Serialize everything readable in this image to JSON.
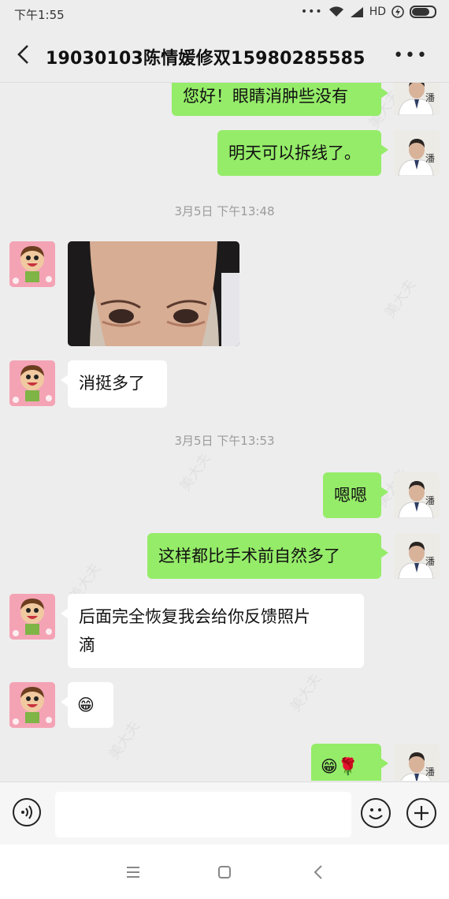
{
  "status_bar": {
    "time": "下午1:55",
    "network": "HD"
  },
  "header": {
    "title": "19030103陈情媛修双15980285585",
    "more": "•••"
  },
  "messages": [
    {
      "side": "right",
      "text": "您好！眼睛消肿些没有"
    },
    {
      "side": "right",
      "text": "明天可以拆线了。"
    },
    {
      "type": "timestamp",
      "text": "3月5日 下午13:48"
    },
    {
      "side": "left",
      "type": "image"
    },
    {
      "side": "left",
      "text": "消挺多了"
    },
    {
      "type": "timestamp",
      "text": "3月5日 下午13:53"
    },
    {
      "side": "right",
      "text": "嗯嗯"
    },
    {
      "side": "right",
      "text": "这样都比手术前自然多了"
    },
    {
      "side": "left",
      "line1": "后面完全恢复我会给你反馈照片",
      "line2": "滴"
    },
    {
      "side": "left",
      "text": "😁"
    },
    {
      "side": "right",
      "text": "😁🌹"
    }
  ],
  "doctor_avatar": {
    "sign": "潘武"
  },
  "colors": {
    "sent_bubble": "#95ec69",
    "received_bubble": "#ffffff",
    "background": "#ededed"
  }
}
